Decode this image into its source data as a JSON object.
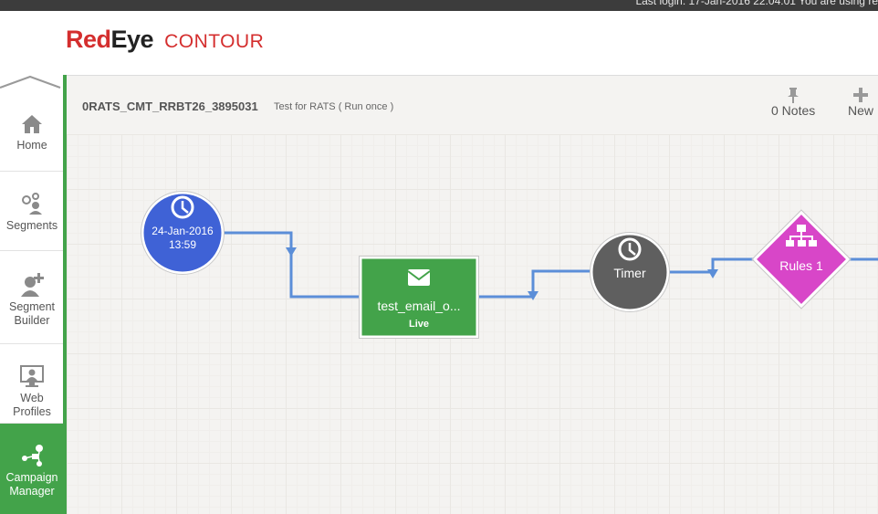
{
  "topbar": {
    "login_text": "Last login: 17-Jan-2016 22:04:01 You are using re"
  },
  "brand": {
    "logo_red": "Red",
    "logo_dark": "Eye",
    "product": "CONTOUR"
  },
  "sidebar": {
    "items": [
      {
        "label": "Home",
        "icon": "home-icon"
      },
      {
        "label": "Segments",
        "icon": "segments-icon"
      },
      {
        "label_line1": "Segment",
        "label_line2": "Builder",
        "icon": "segment-builder-icon"
      },
      {
        "label": "Web Profiles",
        "icon": "web-profiles-icon"
      },
      {
        "label_line1": "Campaign",
        "label_line2": "Manager",
        "icon": "campaign-manager-icon",
        "active": true
      }
    ]
  },
  "canvas": {
    "campaign_name": "0RATS_CMT_RRBT26_3895031",
    "campaign_desc": "Test for RATS ( Run once )",
    "notes_label": "0 Notes",
    "new_label": "New"
  },
  "flow": {
    "start": {
      "date": "24-Jan-2016",
      "time": "13:59",
      "color": "#3f62d6",
      "icon": "clock-icon"
    },
    "email": {
      "title": "test_email_o...",
      "status": "Live",
      "color": "#43a34a",
      "icon": "envelope-icon"
    },
    "timer": {
      "label": "Timer",
      "color": "#5f5f5f",
      "icon": "clock-icon"
    },
    "rules": {
      "label": "Rules 1",
      "color": "#d846c8",
      "icon": "hierarchy-icon"
    },
    "connector_color": "#5b8ed8"
  },
  "colors": {
    "brand_red": "#d42e2e",
    "active_green": "#43a34a"
  }
}
